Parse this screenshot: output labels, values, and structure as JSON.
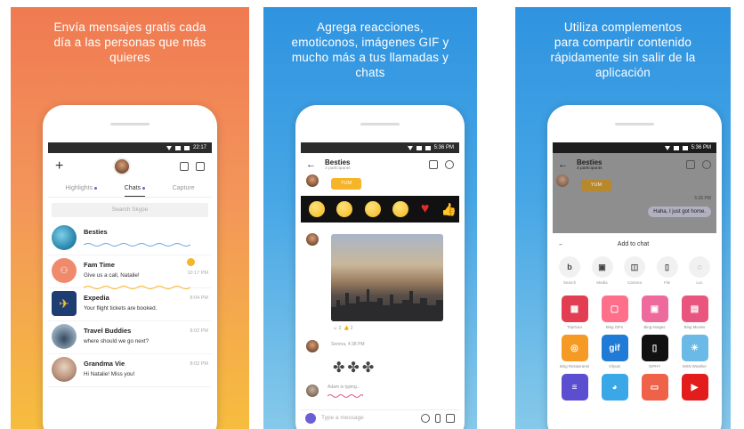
{
  "panels": {
    "p1": {
      "caption": [
        "Envía mensajes gratis cada",
        "día a las personas que más",
        "quieres"
      ]
    },
    "p2": {
      "caption": [
        "Agrega reacciones,",
        "emoticonos, imágenes GIF y",
        "mucho más a tus llamadas y",
        "chats"
      ]
    },
    "p3": {
      "caption": [
        "Utiliza complementos",
        "para compartir contenido",
        "rápidamente sin salir de la",
        "aplicación"
      ]
    }
  },
  "chats_screen": {
    "status_time": "22:17",
    "tabs": [
      "Highlights",
      "Chats",
      "Capture"
    ],
    "search_placeholder": "Search Skype",
    "chats": [
      {
        "name": "Besties",
        "message": "",
        "time": ""
      },
      {
        "name": "Fam Time",
        "message": "Give us a call, Natalie!",
        "time": "10:17 PM"
      },
      {
        "name": "Expedia",
        "message": "Your flight tickets are booked.",
        "time": "8:04 PM"
      },
      {
        "name": "Travel Buddies",
        "message": "where should we go next?",
        "time": "8:02 PM"
      },
      {
        "name": "Grandma Vie",
        "message": "Hi Natalie! Miss you!",
        "time": "8:02 PM"
      }
    ]
  },
  "conversation_screen": {
    "status_time": "5:36 PM",
    "title": "Besties",
    "subtitle": "3 participants",
    "yum_label": "YUM",
    "reactions_summary": [
      "2",
      "2"
    ],
    "sender_line": "Serena, 4:38 PM",
    "typing_line": "Adam is typing...",
    "message_placeholder": "Type a message"
  },
  "addtochat_screen": {
    "status_time": "5:36 PM",
    "title": "Besties",
    "subtitle": "3 participants",
    "yum_label": "YUM",
    "bubble_time": "5:36 PM",
    "bubble_text": "Haha, I just got home.",
    "sheet_title": "Add to chat",
    "tools": [
      {
        "glyph": "b",
        "label": "Search"
      },
      {
        "glyph": "▣",
        "label": "Media"
      },
      {
        "glyph": "◫",
        "label": "Camera"
      },
      {
        "glyph": "▯",
        "label": "File"
      },
      {
        "glyph": "◌",
        "label": "Loc"
      }
    ],
    "apps": [
      {
        "label": "TripGuru",
        "color": "#e23d52",
        "glyph": "▦"
      },
      {
        "label": "Bing GIFs",
        "color": "#ff6f8a",
        "glyph": "▢"
      },
      {
        "label": "Bing Images",
        "color": "#ef6a9c",
        "glyph": "▣"
      },
      {
        "label": "Bing Movies",
        "color": "#e9557e",
        "glyph": "▤"
      },
      {
        "label": "Bing Restaurants",
        "color": "#f59a25",
        "glyph": "◎"
      },
      {
        "label": "Gfycat",
        "color": "#1f7bd6",
        "glyph": "gif"
      },
      {
        "label": "GIPHY",
        "color": "#111111",
        "glyph": "▯"
      },
      {
        "label": "MSN Weather",
        "color": "#6ab9e6",
        "glyph": "☀"
      },
      {
        "label": "",
        "color": "#5b4ed0",
        "glyph": "≡"
      },
      {
        "label": "",
        "color": "#3aa7e6",
        "glyph": "◕"
      },
      {
        "label": "",
        "color": "#f0614a",
        "glyph": "▭"
      },
      {
        "label": "",
        "color": "#e31c1c",
        "glyph": "▶"
      }
    ]
  },
  "colors": {
    "skype_purple": "#6b5fd6",
    "panel1_top": "#f07a52",
    "panel1_bottom": "#f6bd3e",
    "panel_blue": "#2f93e0"
  }
}
